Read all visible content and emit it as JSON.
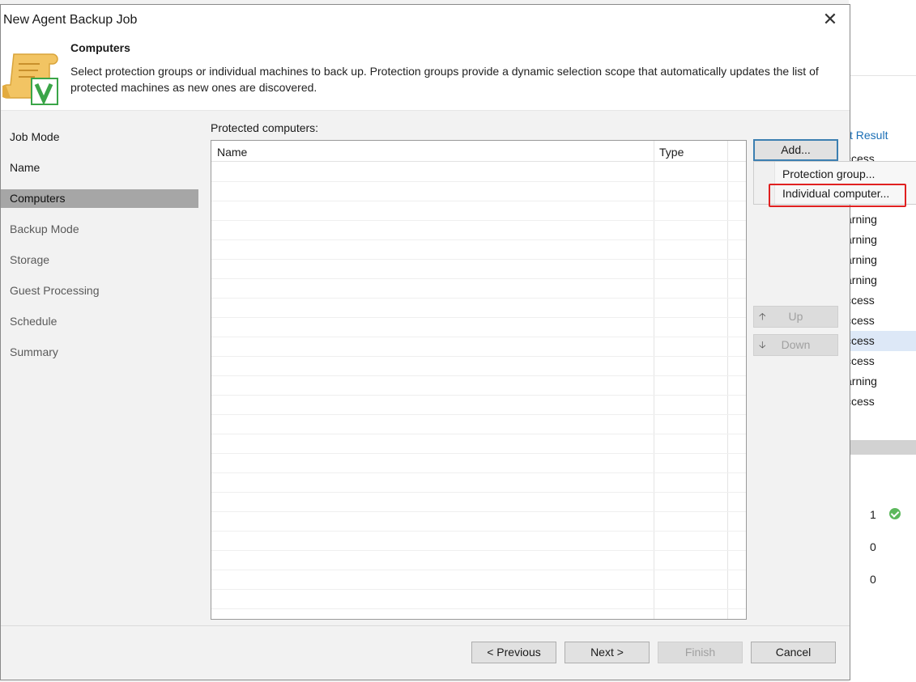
{
  "window": {
    "title": "New Agent Backup Job"
  },
  "header": {
    "title": "Computers",
    "description": "Select protection groups or individual machines to back up. Protection groups provide a dynamic selection scope that automatically updates the list of protected machines as new ones are discovered."
  },
  "steps": [
    {
      "label": "Job Mode",
      "state": "done"
    },
    {
      "label": "Name",
      "state": "done"
    },
    {
      "label": "Computers",
      "state": "active"
    },
    {
      "label": "Backup Mode",
      "state": "inactive"
    },
    {
      "label": "Storage",
      "state": "inactive"
    },
    {
      "label": "Guest Processing",
      "state": "inactive"
    },
    {
      "label": "Schedule",
      "state": "inactive"
    },
    {
      "label": "Summary",
      "state": "inactive"
    }
  ],
  "main": {
    "grid_label": "Protected computers:",
    "columns": [
      "Name",
      "Type"
    ],
    "rows": []
  },
  "buttons": {
    "add": "Add...",
    "up": "Up",
    "down": "Down",
    "previous": "< Previous",
    "next": "Next >",
    "finish": "Finish",
    "cancel": "Cancel"
  },
  "add_menu": {
    "items": [
      "Protection group...",
      "Individual computer..."
    ],
    "highlighted": "Individual computer..."
  },
  "background_app": {
    "column_header": "st Result",
    "rows": [
      "ccess",
      "ccess",
      "ccess",
      "arning",
      "arning",
      "arning",
      "arning",
      "ccess",
      "ccess",
      "ccess",
      "ccess",
      "arning",
      "ccess"
    ],
    "selected_row": 9,
    "stats": [
      "1",
      "0",
      "0"
    ]
  },
  "colors": {
    "highlight_box": "#e02020",
    "active_step_bg": "#a6a6a6",
    "link_blue": "#1b6fb6",
    "success_green": "#5cb85c"
  }
}
